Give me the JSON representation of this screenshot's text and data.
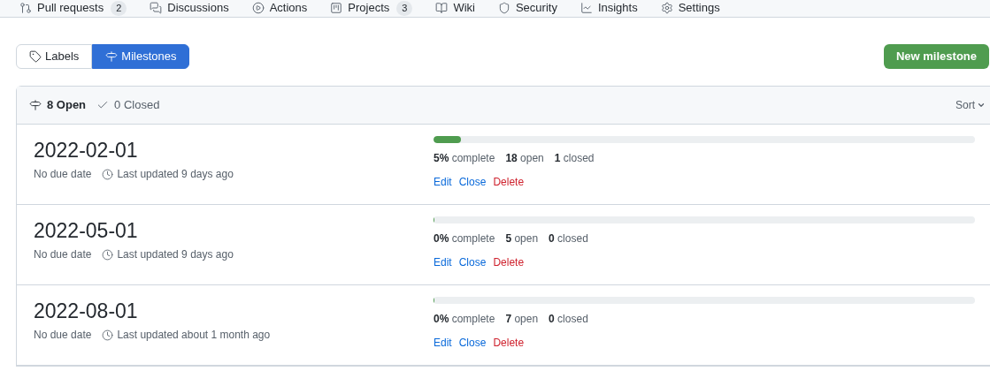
{
  "repo_nav": [
    {
      "label": "Pull requests",
      "kind": "pull",
      "count": "2"
    },
    {
      "label": "Discussions",
      "kind": "discussion"
    },
    {
      "label": "Actions",
      "kind": "play"
    },
    {
      "label": "Projects",
      "kind": "project",
      "count": "3"
    },
    {
      "label": "Wiki",
      "kind": "book"
    },
    {
      "label": "Security",
      "kind": "shield"
    },
    {
      "label": "Insights",
      "kind": "graph"
    },
    {
      "label": "Settings",
      "kind": "gear"
    }
  ],
  "subnav": [
    {
      "label": "Labels",
      "kind": "tag",
      "selected": false
    },
    {
      "label": "Milestones",
      "kind": "milestone",
      "selected": true
    }
  ],
  "new_button": "New milestone",
  "filter": [
    {
      "label": "8 Open",
      "kind": "milestone",
      "selected": true
    },
    {
      "label": "0 Closed",
      "kind": "check",
      "selected": false
    }
  ],
  "sort": "Sort",
  "milestones": [
    {
      "title": "2022-02-01",
      "due": "No due date",
      "updated": "Last updated 9 days ago",
      "level": 0.05,
      "complete": "**5%** complete",
      "open": "**18** open",
      "closed": "**1** closed",
      "actions": [
        "Edit",
        "Close",
        "Delete"
      ]
    },
    {
      "title": "2022-05-01",
      "due": "No due date",
      "updated": "Last updated 9 days ago",
      "level": 0,
      "complete": "**0%** complete",
      "open": "**5** open",
      "closed": "**0** closed",
      "actions": [
        "Edit",
        "Close",
        "Delete"
      ]
    },
    {
      "title": "2022-08-01",
      "due": "No due date",
      "updated": "Last updated about 1 month ago",
      "level": 0,
      "complete": "**0%** complete",
      "open": "**7** open",
      "closed": "**0** closed",
      "actions": [
        "Edit",
        "Close",
        "Delete"
      ]
    }
  ]
}
